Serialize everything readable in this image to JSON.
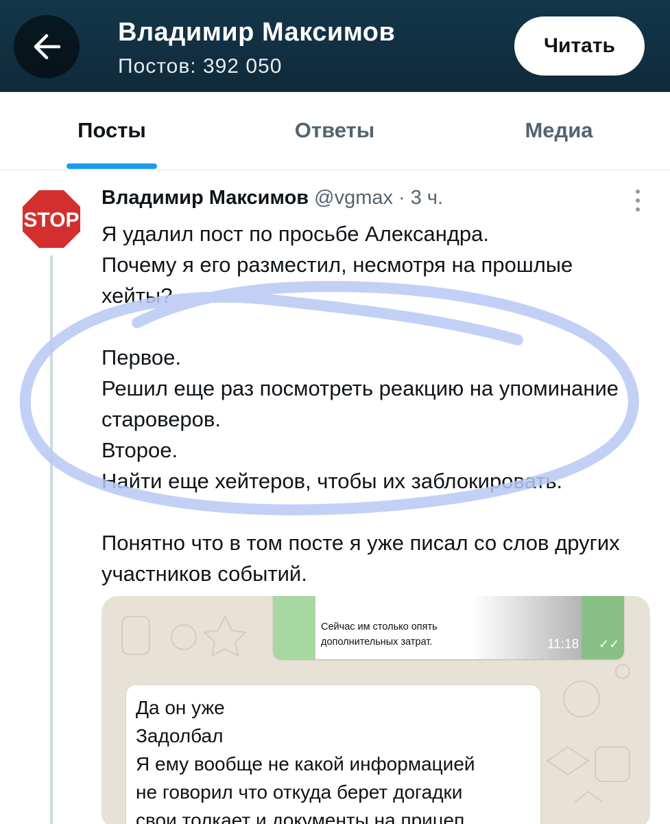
{
  "header": {
    "title": "Владимир Максимов",
    "subtitle": "Постов: 392 050",
    "read_button": "Читать",
    "back_icon": "arrow-left-icon"
  },
  "tabs": [
    {
      "label": "Посты",
      "active": true
    },
    {
      "label": "Ответы",
      "active": false
    },
    {
      "label": "Медиа",
      "active": false
    }
  ],
  "post": {
    "avatar_text": "STOP",
    "author": "Владимир Максимов",
    "handle": "@vgmax · 3 ч.",
    "paragraphs": [
      "Я удалил пост по просьбе Александра.",
      "Почему я его разместил, несмотря на прошлые хейты?",
      "",
      "Первое.",
      "Решил еще раз посмотреть реакцию на упоминание староверов.",
      "Второе.",
      "Найти еще хейтеров, чтобы их заблокировать.",
      "",
      "Понятно что в том посте я уже писал со слов других участников событий."
    ]
  },
  "media": {
    "outgoing_text_1": "Сейчас им столько опять",
    "outgoing_text_2": "дополнительных затрат.",
    "outgoing_time": "11:18",
    "incoming_lines": [
      "Да он уже",
      "Задолбал",
      "Я ему вообще не какой информацией",
      "не говорил что откуда берет догадки",
      "свои толкает и документы на прицеп"
    ]
  },
  "colors": {
    "header_bg": "#14364a",
    "accent": "#1d9bf0",
    "annotation": "#b9c8f5",
    "stop_red": "#d32f2f"
  }
}
